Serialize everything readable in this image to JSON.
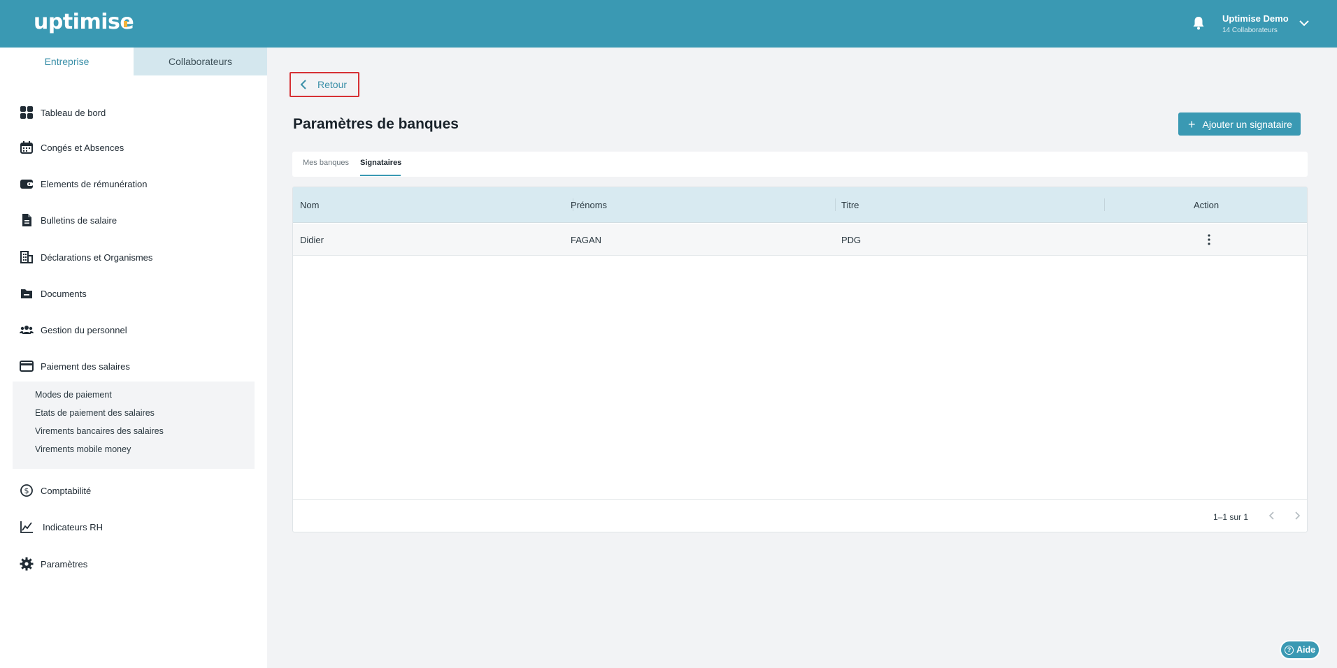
{
  "header": {
    "logo_text": "uptimise",
    "user_name": "Uptimise Demo",
    "user_sub": "14 Collaborateurs",
    "icons": [
      "bell-icon",
      "chevron-down-icon"
    ]
  },
  "sidebar": {
    "tabs": [
      {
        "label": "Entreprise",
        "active": true
      },
      {
        "label": "Collaborateurs",
        "active": false
      }
    ],
    "items": [
      {
        "label": "Tableau de bord",
        "icon": "dashboard-grid-icon"
      },
      {
        "label": "Congés et Absences",
        "icon": "calendar-icon"
      },
      {
        "label": "Elements de rémunération",
        "icon": "wallet-icon"
      },
      {
        "label": "Bulletins de salaire",
        "icon": "document-icon"
      },
      {
        "label": "Déclarations et Organismes",
        "icon": "building-icon"
      },
      {
        "label": "Documents",
        "icon": "folder-icon"
      },
      {
        "label": "Gestion du personnel",
        "icon": "people-icon"
      },
      {
        "label": "Paiement des salaires",
        "icon": "credit-card-icon"
      },
      {
        "label": "Comptabilité",
        "icon": "dollar-circle-icon"
      },
      {
        "label": "Indicateurs RH",
        "icon": "line-chart-icon"
      },
      {
        "label": "Paramètres",
        "icon": "gear-icon"
      }
    ],
    "submenu": [
      "Modes de paiement",
      "Etats de paiement des salaires",
      "Virements bancaires des salaires",
      "Virements mobile money"
    ]
  },
  "main": {
    "back_label": "Retour",
    "title": "Paramètres de banques",
    "add_button": "Ajouter un signataire",
    "tabs": [
      {
        "label": "Mes banques",
        "active": false
      },
      {
        "label": "Signataires",
        "active": true
      }
    ],
    "table": {
      "columns": [
        "Nom",
        "Prénoms",
        "Titre",
        "Action"
      ],
      "rows": [
        {
          "nom": "Didier",
          "prenoms": "FAGAN",
          "titre": "PDG"
        }
      ],
      "pagination": "1–1 sur 1"
    }
  },
  "help": {
    "label": "Aide"
  },
  "colors": {
    "brand": "#3a99b3",
    "sidebar_tab_inactive": "#d4e7ee",
    "table_header": "#d8eaf1",
    "highlight_border": "#d63034"
  }
}
